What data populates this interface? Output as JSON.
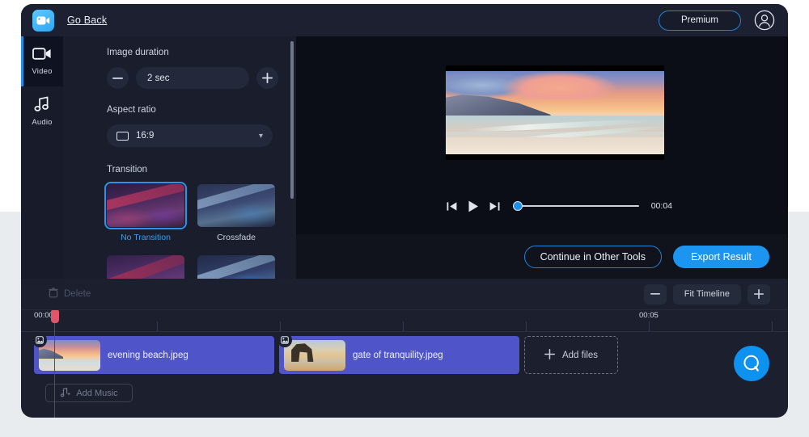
{
  "header": {
    "logo_icon": "video-camera-logo",
    "go_back_label": "Go Back",
    "premium_label": "Premium",
    "avatar_icon": "user-avatar-icon"
  },
  "sidebar": {
    "items": [
      {
        "label": "Video",
        "icon": "video-camera-icon",
        "active": true
      },
      {
        "label": "Audio",
        "icon": "music-note-icon",
        "active": false
      }
    ]
  },
  "settings": {
    "image_duration": {
      "label": "Image duration",
      "value": "2 sec",
      "decrease_icon": "minus-icon",
      "increase_icon": "plus-icon"
    },
    "aspect_ratio": {
      "label": "Aspect ratio",
      "value": "16:9",
      "frame_icon": "frame-icon",
      "chevron_icon": "chevron-down-icon"
    },
    "transition": {
      "label": "Transition",
      "options": [
        {
          "name": "No Transition",
          "selected": true
        },
        {
          "name": "Crossfade",
          "selected": false
        },
        {
          "name": "",
          "selected": false
        },
        {
          "name": "",
          "selected": false
        }
      ]
    }
  },
  "preview": {
    "controls": {
      "prev_icon": "skip-previous-icon",
      "play_icon": "play-icon",
      "next_icon": "skip-next-icon",
      "time": "00:04",
      "progress_percent": 0
    }
  },
  "actions": {
    "continue_label": "Continue in Other Tools",
    "export_label": "Export Result"
  },
  "timeline": {
    "delete_label": "Delete",
    "delete_icon": "trash-icon",
    "zoom_out_icon": "minus-icon",
    "fit_label": "Fit Timeline",
    "zoom_in_icon": "plus-icon",
    "ruler_labels": [
      "00:00",
      "00:05"
    ],
    "clips": [
      {
        "name": "evening beach.jpeg",
        "badge_icon": "image-icon"
      },
      {
        "name": "gate of tranquility.jpeg",
        "badge_icon": "image-icon"
      }
    ],
    "add_files_label": "Add files",
    "add_files_icon": "plus-icon",
    "add_music_label": "Add Music",
    "add_music_icon": "music-add-icon",
    "chat_icon": "chat-bubble-icon"
  },
  "colors": {
    "accent_blue": "#1b95ef",
    "clip_purple": "#4f54c8",
    "playhead_red": "#e0556a",
    "panel_dark": "#191d2c"
  }
}
